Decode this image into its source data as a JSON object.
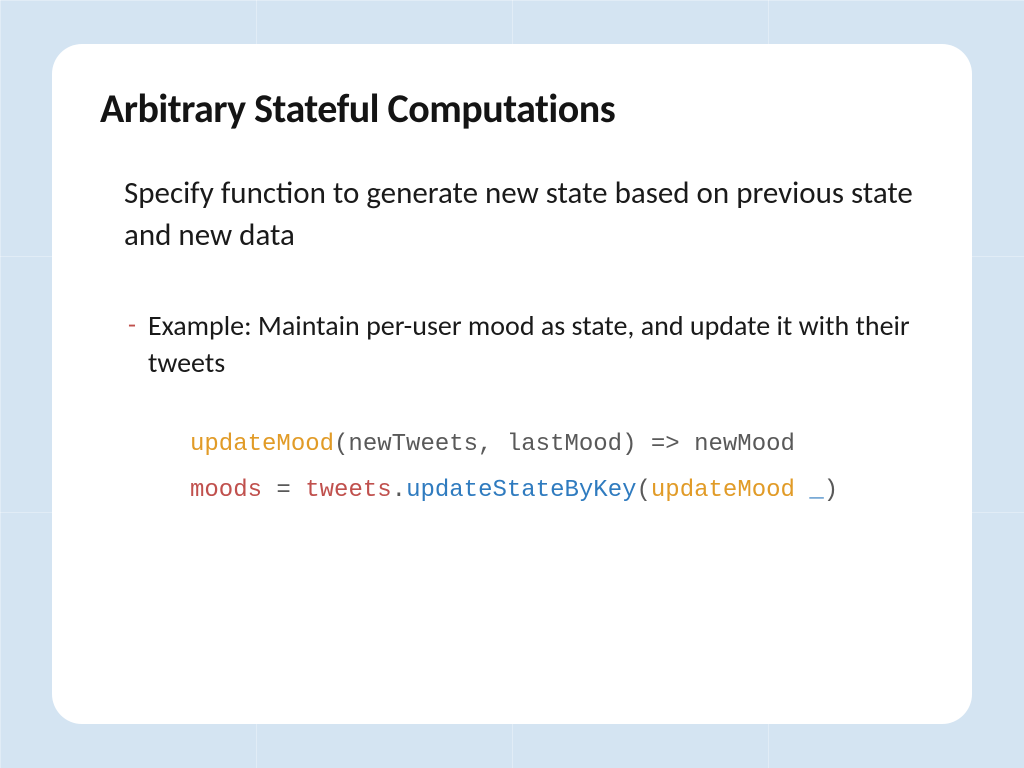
{
  "slide": {
    "title": "Arbitrary Stateful Computations",
    "subtitle": "Specify function to generate new state based on previous state and new data",
    "bullet": "-",
    "example": "Example: Maintain per-user mood as state, and update it with their tweets",
    "code": {
      "line1": {
        "t1": "updateMood",
        "t2": "(newTweets, lastMood) => newMood"
      },
      "line2": {
        "t1": "moods ",
        "t2": "= ",
        "t3": "tweets",
        "t4": ".",
        "t5": "updateStateByKey",
        "t6": "(",
        "t7": "updateMood ",
        "t8": "_",
        "t9": ")"
      }
    }
  }
}
